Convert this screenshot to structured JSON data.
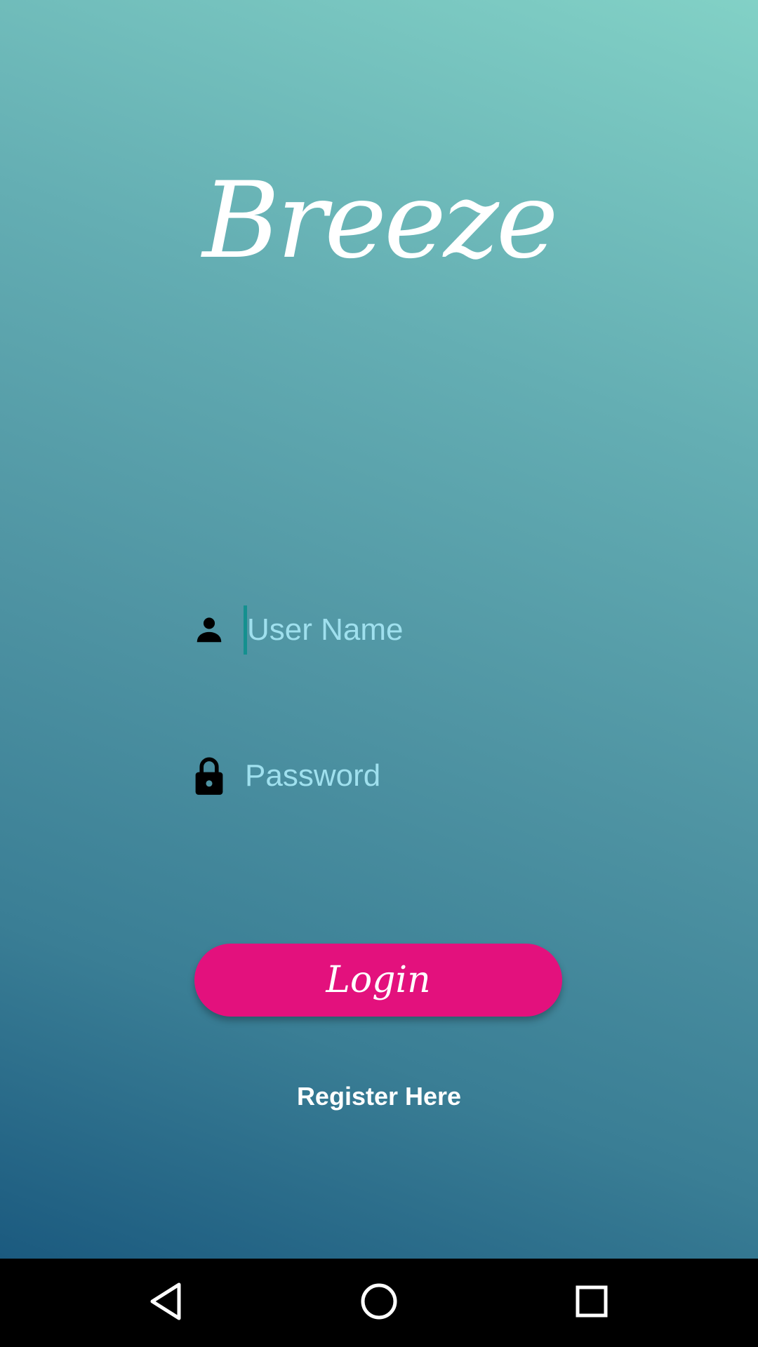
{
  "app": {
    "title": "Breeze"
  },
  "login_form": {
    "username": {
      "placeholder": "User Name",
      "value": "",
      "icon": "person-icon"
    },
    "password": {
      "placeholder": "Password",
      "value": "",
      "icon": "lock-icon"
    },
    "login_label": "Login",
    "register_label": "Register Here"
  },
  "navigation_bar": {
    "buttons": [
      "back-icon",
      "home-icon",
      "recent-apps-icon"
    ]
  },
  "colors": {
    "login_button": "#e3117d",
    "placeholder": "#9fe0ee",
    "cursor": "#14908f",
    "gradient_top": "#82d1c6",
    "gradient_bottom": "#1b5a7f",
    "nav_bar": "#000000"
  }
}
